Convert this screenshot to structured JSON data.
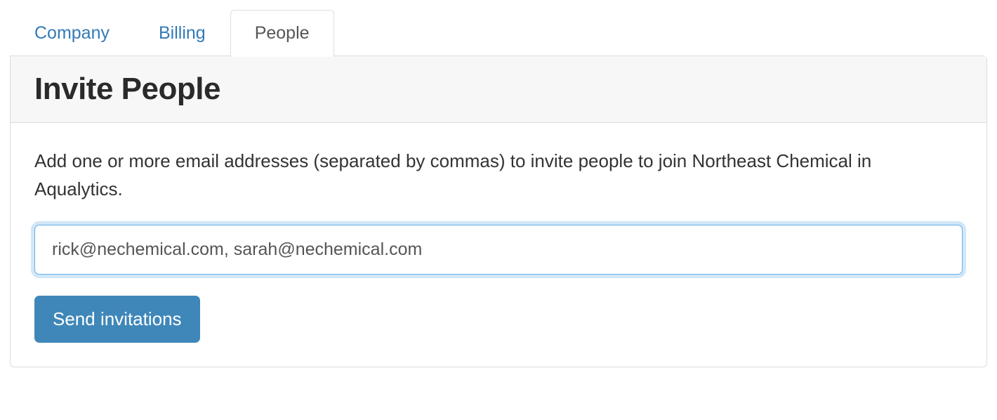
{
  "tabs": [
    {
      "label": "Company",
      "active": false
    },
    {
      "label": "Billing",
      "active": false
    },
    {
      "label": "People",
      "active": true
    }
  ],
  "panel": {
    "title": "Invite People",
    "description": "Add one or more email addresses (separated by commas) to invite people to join Northeast Chemical in Aqualytics.",
    "email_value": "rick@nechemical.com, sarah@nechemical.com",
    "send_button_label": "Send invitations"
  }
}
